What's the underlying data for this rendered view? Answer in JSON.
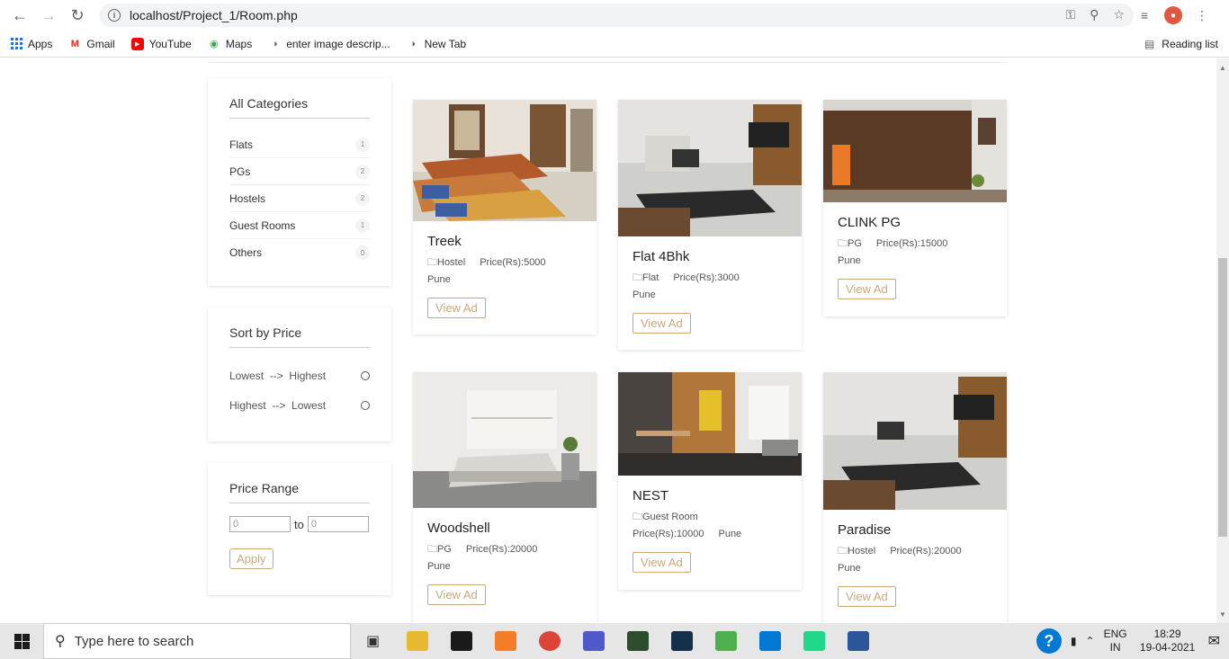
{
  "browser": {
    "url": "localhost/Project_1/Room.php",
    "bookmarks": [
      "Apps",
      "Gmail",
      "YouTube",
      "Maps",
      "enter image descrip...",
      "New Tab"
    ],
    "reading_list": "Reading list"
  },
  "sidebar": {
    "categories_title": "All Categories",
    "categories": [
      {
        "label": "Flats",
        "count": "1"
      },
      {
        "label": "PGs",
        "count": "2"
      },
      {
        "label": "Hostels",
        "count": "2"
      },
      {
        "label": "Guest Rooms",
        "count": "1"
      },
      {
        "label": "Others",
        "count": "0"
      }
    ],
    "sort_title": "Sort by Price",
    "sort_options": [
      "Lowest  -->  Highest",
      "Highest  -->  Lowest"
    ],
    "price_title": "Price Range",
    "price_from": "0",
    "price_to_label": "to",
    "price_to": "0",
    "apply_label": "Apply"
  },
  "listings": [
    {
      "title": "Treek",
      "type": "Hostel",
      "price": "Price(Rs):5000",
      "city": "Pune",
      "button": "View Ad"
    },
    {
      "title": "Flat 4Bhk",
      "type": "Flat",
      "price": "Price(Rs):3000",
      "city": "Pune",
      "button": "View Ad"
    },
    {
      "title": "CLINK PG",
      "type": "PG",
      "price": "Price(Rs):15000",
      "city": "Pune",
      "button": "View Ad"
    },
    {
      "title": "Woodshell",
      "type": "PG",
      "price": "Price(Rs):20000",
      "city": "Pune",
      "button": "View Ad"
    },
    {
      "title": "NEST",
      "type": "Guest Room",
      "price": "Price(Rs):10000",
      "city": "Pune",
      "button": "View Ad"
    },
    {
      "title": "Paradise",
      "type": "Hostel",
      "price": "Price(Rs):20000",
      "city": "Pune",
      "button": "View Ad"
    }
  ],
  "taskbar": {
    "search_placeholder": "Type here to search",
    "lang_top": "ENG",
    "lang_bottom": "IN",
    "time": "18:29",
    "date": "19-04-2021"
  },
  "colors": {
    "accent_button": "#c8a87b",
    "taskbar": "#e6e6e6"
  }
}
